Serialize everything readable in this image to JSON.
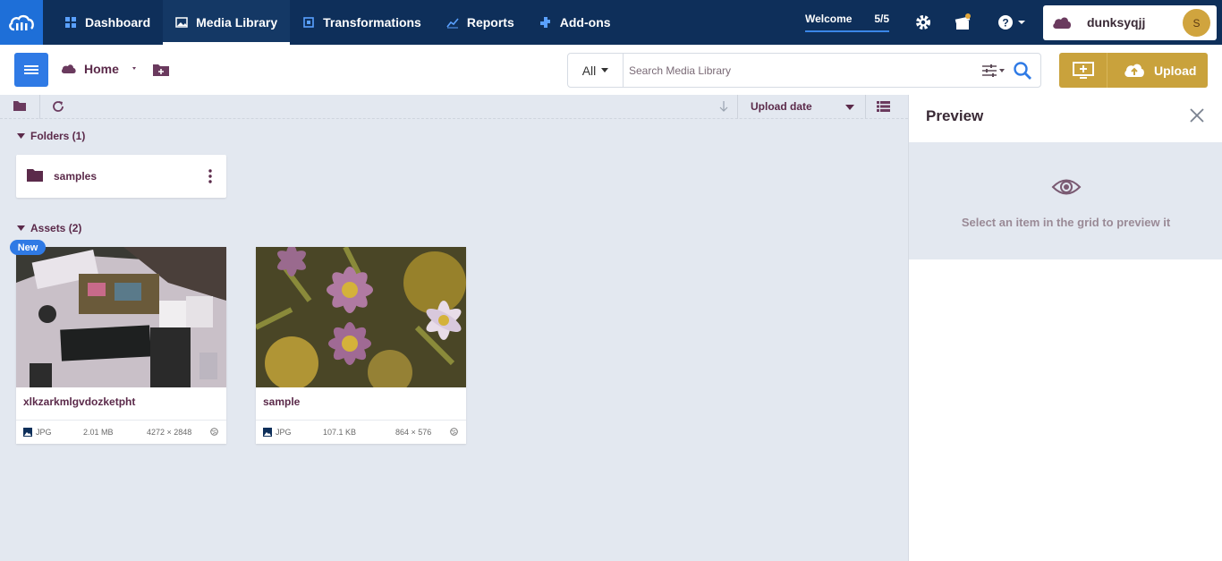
{
  "nav": {
    "items": [
      {
        "label": "Dashboard",
        "icon": "dashboard-icon"
      },
      {
        "label": "Media Library",
        "icon": "media-library-icon"
      },
      {
        "label": "Transformations",
        "icon": "transformations-icon"
      },
      {
        "label": "Reports",
        "icon": "reports-icon"
      },
      {
        "label": "Add-ons",
        "icon": "add-ons-icon"
      }
    ],
    "active": "Media Library",
    "welcome_label": "Welcome",
    "welcome_count": "5/5",
    "username": "dunksyqjj",
    "avatar_initial": "S"
  },
  "toolbar": {
    "home_label": "Home",
    "search_scope": "All",
    "search_placeholder": "Search Media Library",
    "upload_label": "Upload"
  },
  "sort": {
    "label": "Upload date"
  },
  "folders": {
    "title": "Folders (1)",
    "items": [
      {
        "name": "samples"
      }
    ]
  },
  "assets": {
    "title": "Assets (2)",
    "new_badge": "New",
    "items": [
      {
        "name": "xlkzarkmlgvdozketpht",
        "format": "JPG",
        "size": "2.01 MB",
        "dimensions": "4272 × 2848"
      },
      {
        "name": "sample",
        "format": "JPG",
        "size": "107.1 KB",
        "dimensions": "864 × 576"
      }
    ]
  },
  "preview": {
    "title": "Preview",
    "empty_message": "Select an item in the grid to preview it"
  },
  "colors": {
    "nav_bg": "#0e2f5a",
    "accent_blue": "#2f7ae5",
    "upload_gold": "#c9a23c",
    "text_plum": "#5b2a4a"
  }
}
